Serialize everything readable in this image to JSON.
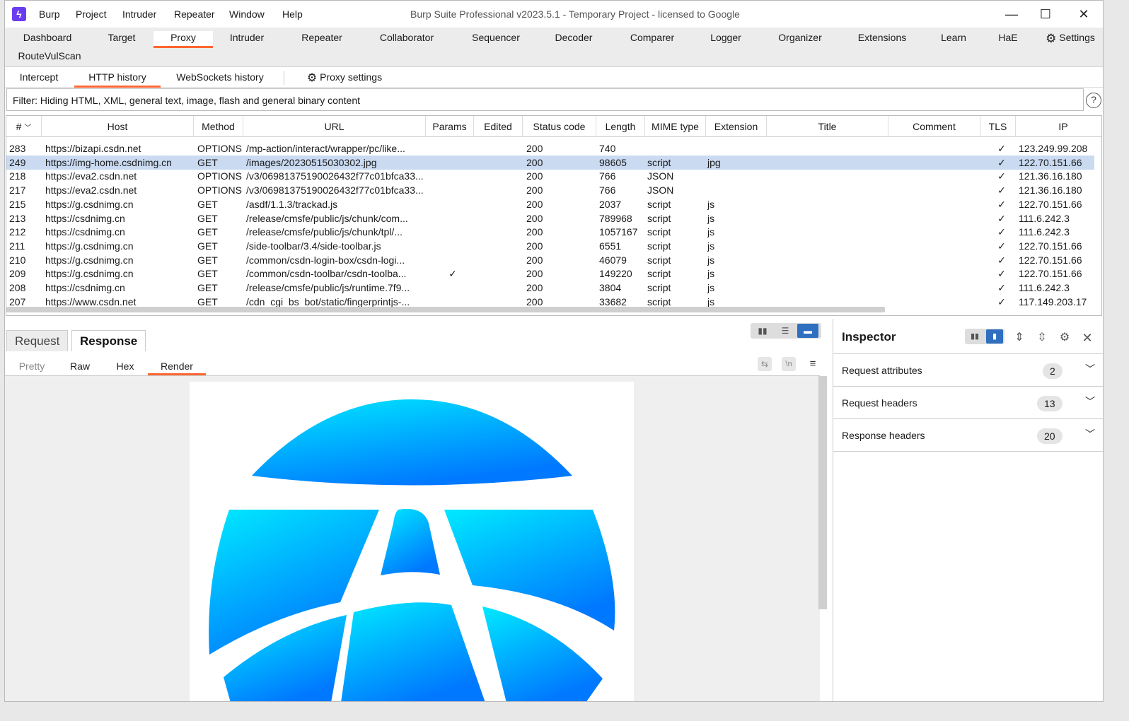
{
  "titlebar": {
    "title": "Burp Suite Professional v2023.5.1 - Temporary Project - licensed to Google",
    "menu": [
      "Burp",
      "Project",
      "Intruder",
      "Repeater",
      "Window",
      "Help"
    ],
    "minimize": "—",
    "maximize": "☐",
    "close": "✕"
  },
  "top_tabs": [
    "Dashboard",
    "Target",
    "Proxy",
    "Intruder",
    "Repeater",
    "Collaborator",
    "Sequencer",
    "Decoder",
    "Comparer",
    "Logger",
    "Organizer",
    "Extensions",
    "Learn",
    "HaE",
    "Settings",
    "RouteVulScan"
  ],
  "active_top_tab": "Proxy",
  "proxy_tabs": [
    "Intercept",
    "HTTP history",
    "WebSockets history",
    "Proxy settings"
  ],
  "active_proxy_tab": "HTTP history",
  "filter": {
    "text": "Filter: Hiding HTML, XML, general text, image, flash and general binary content",
    "help": "?"
  },
  "history_table": {
    "columns": [
      "#",
      "Host",
      "Method",
      "URL",
      "Params",
      "Edited",
      "Status code",
      "Length",
      "MIME type",
      "Extension",
      "Title",
      "Comment",
      "TLS",
      "IP"
    ],
    "rows": [
      {
        "id": "283",
        "host": "https://bizapi.csdn.net",
        "method": "OPTIONS",
        "url": "/mp-action/interact/wrapper/pc/like...",
        "params": "",
        "status": "200",
        "length": "740",
        "mime": "",
        "ext": "",
        "tls": "✓",
        "ip": "123.249.99.208"
      },
      {
        "id": "249",
        "host": "https://img-home.csdnimg.cn",
        "method": "GET",
        "url": "/images/20230515030302.jpg",
        "params": "",
        "status": "200",
        "length": "98605",
        "mime": "script",
        "ext": "jpg",
        "tls": "✓",
        "ip": "122.70.151.66",
        "selected": true
      },
      {
        "id": "218",
        "host": "https://eva2.csdn.net",
        "method": "OPTIONS",
        "url": "/v3/06981375190026432f77c01bfca33...",
        "params": "",
        "status": "200",
        "length": "766",
        "mime": "JSON",
        "ext": "",
        "tls": "✓",
        "ip": "121.36.16.180"
      },
      {
        "id": "217",
        "host": "https://eva2.csdn.net",
        "method": "OPTIONS",
        "url": "/v3/06981375190026432f77c01bfca33...",
        "params": "",
        "status": "200",
        "length": "766",
        "mime": "JSON",
        "ext": "",
        "tls": "✓",
        "ip": "121.36.16.180"
      },
      {
        "id": "215",
        "host": "https://g.csdnimg.cn",
        "method": "GET",
        "url": "/asdf/1.1.3/trackad.js",
        "params": "",
        "status": "200",
        "length": "2037",
        "mime": "script",
        "ext": "js",
        "tls": "✓",
        "ip": "122.70.151.66"
      },
      {
        "id": "213",
        "host": "https://csdnimg.cn",
        "method": "GET",
        "url": "/release/cmsfe/public/js/chunk/com...",
        "params": "",
        "status": "200",
        "length": "789968",
        "mime": "script",
        "ext": "js",
        "tls": "✓",
        "ip": "111.6.242.3"
      },
      {
        "id": "212",
        "host": "https://csdnimg.cn",
        "method": "GET",
        "url": "/release/cmsfe/public/js/chunk/tpl/...",
        "params": "",
        "status": "200",
        "length": "1057167",
        "mime": "script",
        "ext": "js",
        "tls": "✓",
        "ip": "111.6.242.3"
      },
      {
        "id": "211",
        "host": "https://g.csdnimg.cn",
        "method": "GET",
        "url": "/side-toolbar/3.4/side-toolbar.js",
        "params": "",
        "status": "200",
        "length": "6551",
        "mime": "script",
        "ext": "js",
        "tls": "✓",
        "ip": "122.70.151.66"
      },
      {
        "id": "210",
        "host": "https://g.csdnimg.cn",
        "method": "GET",
        "url": "/common/csdn-login-box/csdn-logi...",
        "params": "",
        "status": "200",
        "length": "46079",
        "mime": "script",
        "ext": "js",
        "tls": "✓",
        "ip": "122.70.151.66"
      },
      {
        "id": "209",
        "host": "https://g.csdnimg.cn",
        "method": "GET",
        "url": "/common/csdn-toolbar/csdn-toolba...",
        "params": "✓",
        "status": "200",
        "length": "149220",
        "mime": "script",
        "ext": "js",
        "tls": "✓",
        "ip": "122.70.151.66"
      },
      {
        "id": "208",
        "host": "https://csdnimg.cn",
        "method": "GET",
        "url": "/release/cmsfe/public/js/runtime.7f9...",
        "params": "",
        "status": "200",
        "length": "3804",
        "mime": "script",
        "ext": "js",
        "tls": "✓",
        "ip": "111.6.242.3"
      },
      {
        "id": "207",
        "host": "https://www.csdn.net",
        "method": "GET",
        "url": "/cdn_cgi_bs_bot/static/fingerprintjs-...",
        "params": "",
        "status": "200",
        "length": "33682",
        "mime": "script",
        "ext": "js",
        "tls": "✓",
        "ip": "117.149.203.17"
      }
    ]
  },
  "message_tabs": [
    "Request",
    "Response"
  ],
  "active_message_tab": "Response",
  "view_tabs": [
    "Pretty",
    "Raw",
    "Hex",
    "Render"
  ],
  "active_view_tab": "Render",
  "inspector": {
    "title": "Inspector",
    "sections": [
      {
        "label": "Request attributes",
        "count": "2"
      },
      {
        "label": "Request headers",
        "count": "13"
      },
      {
        "label": "Response headers",
        "count": "20"
      }
    ]
  },
  "colors": {
    "accent": "#ff6633",
    "selected_row": "#c9daf1",
    "logo_top": "#00e5ff",
    "logo_bottom": "#0080ff"
  }
}
